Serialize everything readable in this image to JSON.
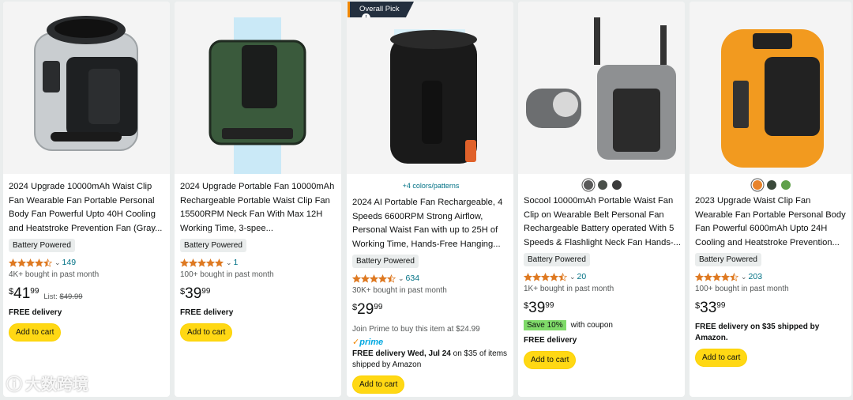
{
  "colors": {
    "cart_button": "#ffd814",
    "link": "#007185",
    "star": "#de7921",
    "coupon_tag": "#7fda69",
    "prime": "#00a8e1",
    "overall_pick_bg": "#232f3e"
  },
  "overall_pick": {
    "label": "Overall Pick",
    "icon": "info-icon"
  },
  "products": [
    {
      "title": "2024 Upgrade 10000mAh Waist Clip Fan Wearable Fan Portable Personal Body Fan Powerful Upto 40H Cooling and Heatstroke Prevention Fan (Gray...",
      "badge": "Battery Powered",
      "rating": 4.5,
      "rating_count": "149",
      "bought": "4K+ bought in past month",
      "price_symbol": "$",
      "price_whole": "41",
      "price_fraction": "99",
      "list_label": "List:",
      "list_price": "$49.99",
      "delivery": "FREE delivery",
      "cart_label": "Add to cart"
    },
    {
      "title": "2024 Upgrade Portable Fan 10000mAh Rechargeable Portable Waist Clip Fan 15500RPM Neck Fan With Max 12H Working Time, 3-spee...",
      "badge": "Battery Powered",
      "rating": 5,
      "rating_count": "1",
      "bought": "100+ bought in past month",
      "price_symbol": "$",
      "price_whole": "39",
      "price_fraction": "99",
      "delivery": "FREE delivery",
      "cart_label": "Add to cart"
    },
    {
      "colors_link": "+4 colors/patterns",
      "title": "2024 AI Portable Fan Rechargeable, 4 Speeds 6600RPM Strong Airflow, Personal Waist Fan with up to 25H of Working Time, Hands-Free Hanging...",
      "badge": "Battery Powered",
      "rating": 4.5,
      "rating_count": "634",
      "bought": "30K+ bought in past month",
      "price_symbol": "$",
      "price_whole": "29",
      "price_fraction": "99",
      "prime_note": "Join Prime to buy this item at $24.99",
      "prime_label": "prime",
      "delivery_prefix": "FREE delivery ",
      "delivery_date": "Wed, Jul 24",
      "delivery_suffix": " on $35 of items shipped by Amazon",
      "cart_label": "Add to cart"
    },
    {
      "swatches": [
        "#5a5a5a",
        "#4a4f4a",
        "#3a3a3a"
      ],
      "title": "Socool 10000mAh Portable Waist Fan Clip on Wearable Belt Personal Fan Rechargeable Battery operated With 5 Speeds & Flashlight Neck Fan Hands-...",
      "badge": "Battery Powered",
      "rating": 4.5,
      "rating_count": "20",
      "bought": "1K+ bought in past month",
      "price_symbol": "$",
      "price_whole": "39",
      "price_fraction": "99",
      "coupon_tag": "Save 10%",
      "coupon_text": "with coupon",
      "delivery": "FREE delivery",
      "cart_label": "Add to cart"
    },
    {
      "swatches": [
        "#e8832a",
        "#3b4a3b",
        "#5fa04a"
      ],
      "title": "2023 Upgrade Waist Clip Fan Wearable Fan Portable Personal Body Fan Powerful 6000mAh Upto 24H Cooling and Heatstroke Prevention...",
      "badge": "Battery Powered",
      "rating": 4.5,
      "rating_count": "203",
      "bought": "100+ bought in past month",
      "price_symbol": "$",
      "price_whole": "33",
      "price_fraction": "99",
      "delivery": "FREE delivery on $35 shipped by Amazon.",
      "cart_label": "Add to cart"
    }
  ],
  "watermark": "大数跨境"
}
